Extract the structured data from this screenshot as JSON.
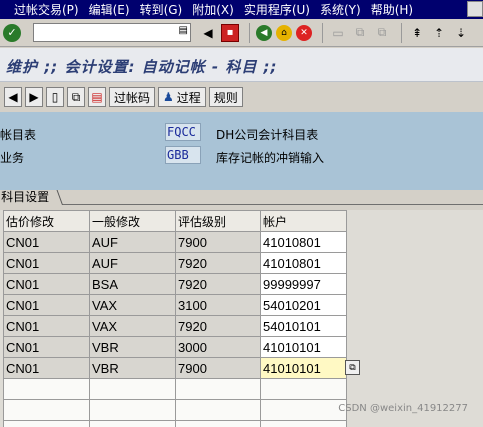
{
  "menu": {
    "items": [
      "过帐交易(P)",
      "编辑(E)",
      "转到(G)",
      "附加(X)",
      "实用程序(U)",
      "系统(Y)",
      "帮助(H)"
    ]
  },
  "toolbar": {
    "command_value": "",
    "ok_icon": "check-icon",
    "dropdown_icon": "list-icon"
  },
  "title": "维护 ;; 会计设置: 自动记帐 - 科目 ;;",
  "app_toolbar": {
    "post_key_label": "过帐码",
    "procedure_label": "过程",
    "rules_label": "规则"
  },
  "header": {
    "chart_label": "帐目表",
    "chart_value": "FQCC",
    "chart_desc": "DH公司会计科目表",
    "trans_label": "业务",
    "trans_value": "GBB",
    "trans_desc": "库存记帐的冲销输入"
  },
  "tab": {
    "label": "科目设置"
  },
  "table": {
    "headers": [
      "估价修改",
      "一般修改",
      "评估级别",
      "帐户"
    ],
    "rows": [
      [
        "CN01",
        "AUF",
        "7900",
        "41010801"
      ],
      [
        "CN01",
        "AUF",
        "7920",
        "41010801"
      ],
      [
        "CN01",
        "BSA",
        "7920",
        "99999997"
      ],
      [
        "CN01",
        "VAX",
        "3100",
        "54010201"
      ],
      [
        "CN01",
        "VAX",
        "7920",
        "54010101"
      ],
      [
        "CN01",
        "VBR",
        "3000",
        "41010101"
      ],
      [
        "CN01",
        "VBR",
        "7900",
        "41010101"
      ]
    ]
  },
  "watermark": "CSDN @weixin_41912277"
}
